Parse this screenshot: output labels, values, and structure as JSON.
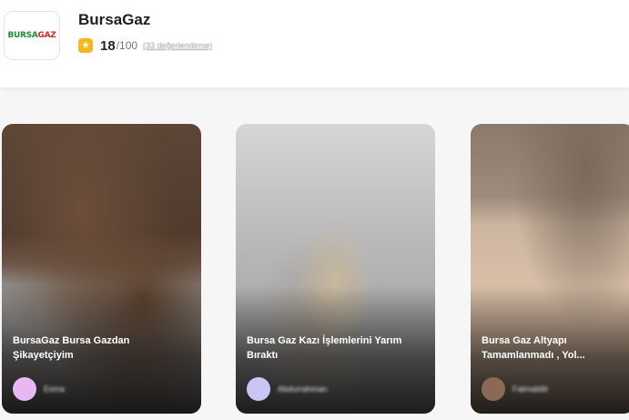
{
  "brand": {
    "logo_part1": "BURSA",
    "logo_part2": "GAZ",
    "name": "BursaGaz",
    "score": "18",
    "score_max": "/100",
    "reviews_text": "(33 değerlendirme)"
  },
  "cards": [
    {
      "title": "BursaGaz Bursa Gazdan Şikayetçiyim",
      "author": "Esma"
    },
    {
      "title": "Bursa Gaz Kazı İşlemlerini Yarım Bıraktı",
      "author": "Abdurrahman"
    },
    {
      "title": "Bursa Gaz Altyapı Tamamlanmadı , Yol...",
      "author": "Fatmabilir"
    }
  ],
  "colors": {
    "star_badge": "#f5b623",
    "logo_green": "#1f8a3b",
    "logo_red": "#d8262d"
  },
  "icons": {
    "rating": "star-icon"
  }
}
